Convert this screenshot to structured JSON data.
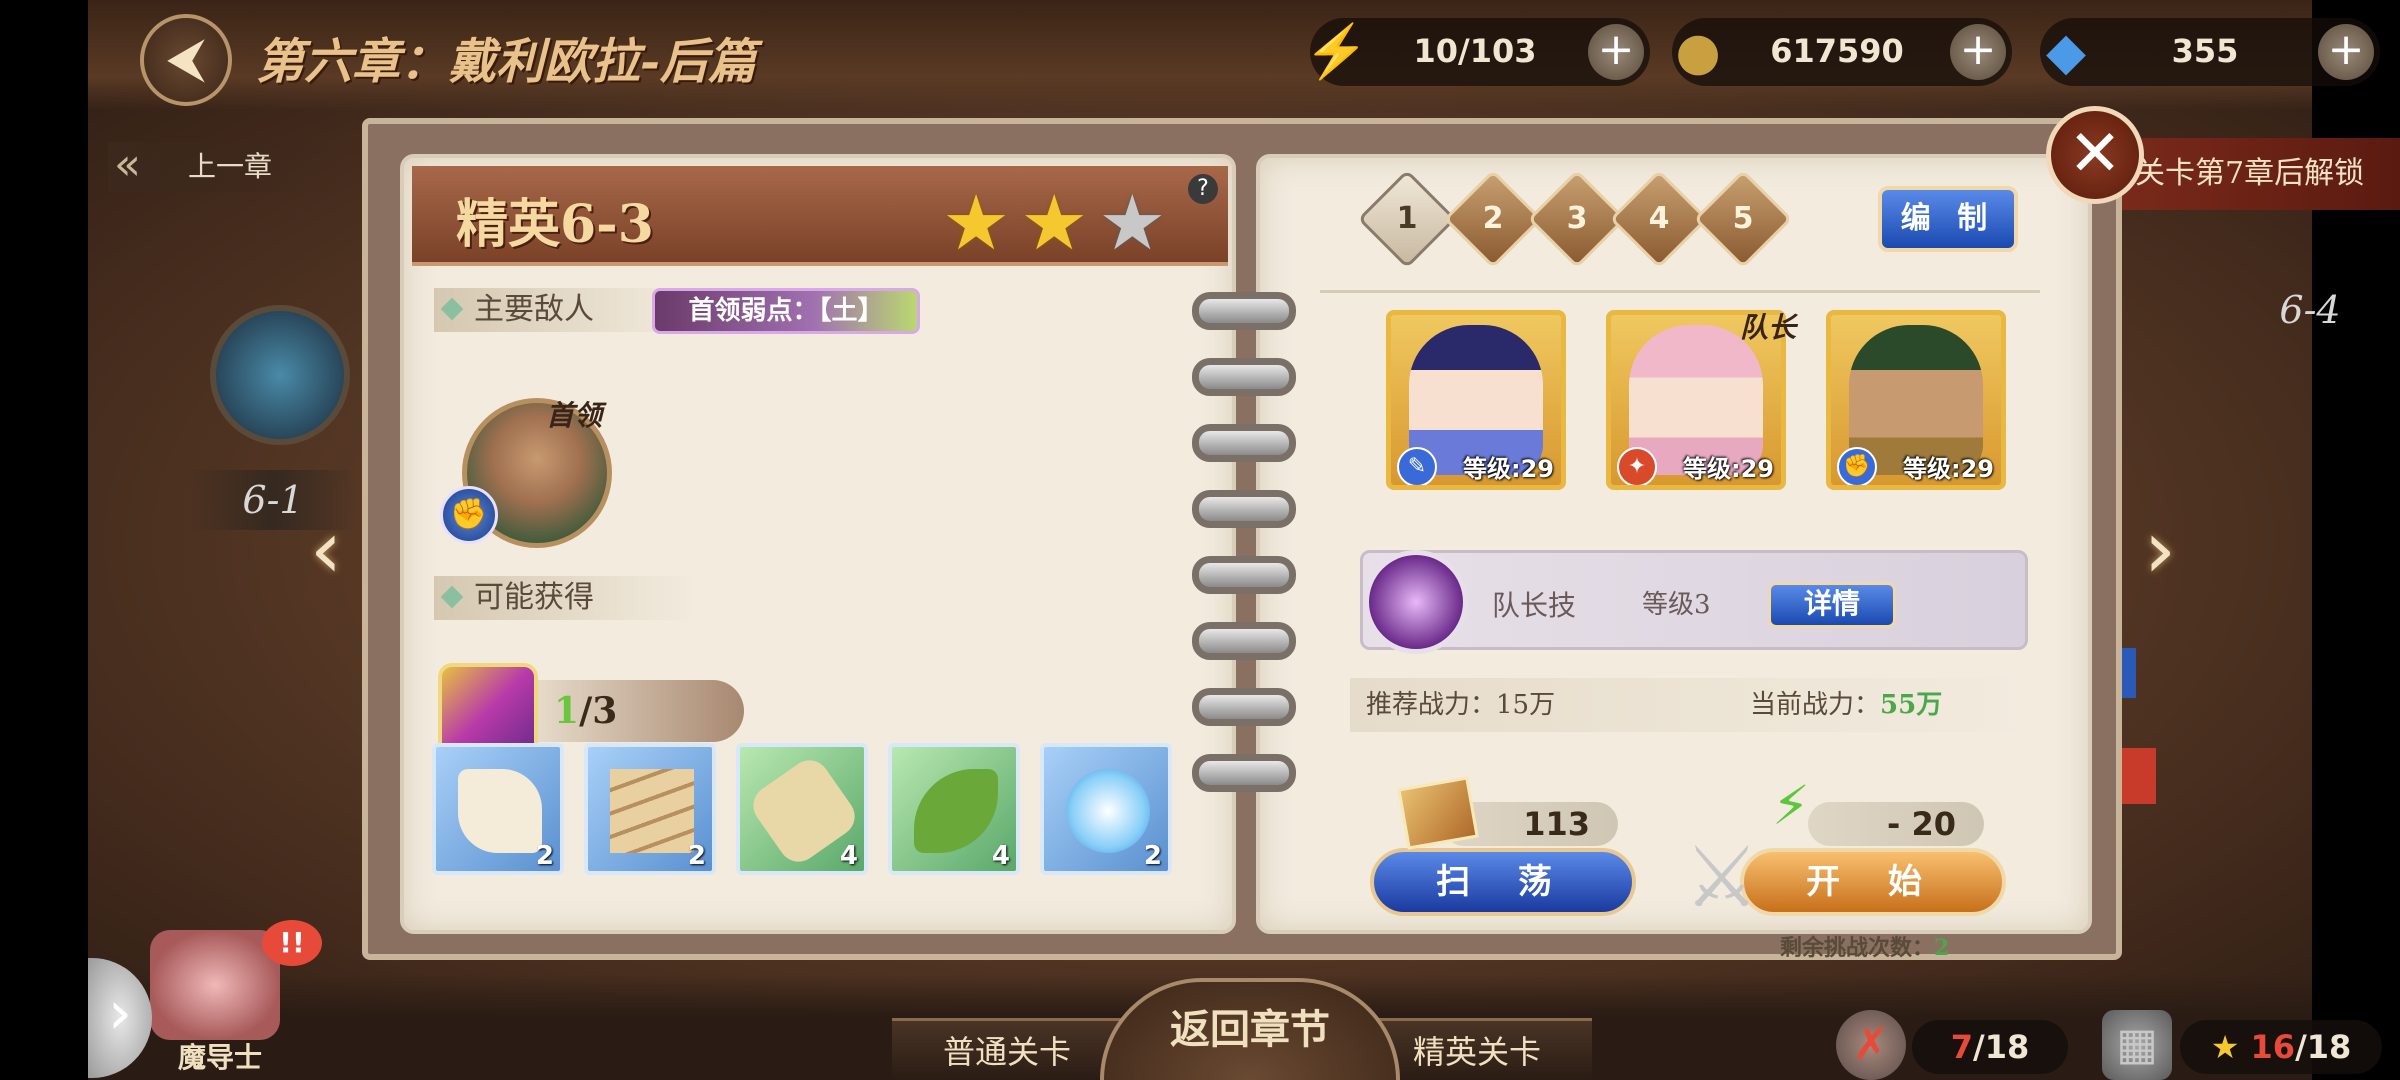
{
  "header": {
    "back_icon": "back-arrow-icon",
    "chapter_title": "第六章：戴利欧拉-后篇",
    "resources": [
      {
        "icon": "stamina-bolt-icon",
        "value": "10/103"
      },
      {
        "icon": "gold-coin-icon",
        "value": "617590"
      },
      {
        "icon": "blue-gem-icon",
        "value": "355"
      }
    ]
  },
  "map": {
    "prev_chapter": "上一章",
    "left_stage": "6-1",
    "right_stage": "6-4",
    "lock_notice": "关卡第7章后解锁"
  },
  "stage": {
    "name": "精英6-3",
    "stars_earned": 2,
    "stars_total": 3,
    "help": "?"
  },
  "enemies": {
    "section_label": "主要敌人",
    "weakness": "首领弱点：【土】",
    "boss_tag": "首领",
    "boss_element_icon": "fist-element-icon"
  },
  "rewards": {
    "section_label": "可能获得",
    "chest_current": "1",
    "chest_total": "/3",
    "drops": [
      {
        "name": "cloth-scroll",
        "qty": "2",
        "rarity": "blue"
      },
      {
        "name": "wood-planks",
        "qty": "2",
        "rarity": "blue"
      },
      {
        "name": "parchment-scroll",
        "qty": "4",
        "rarity": "green"
      },
      {
        "name": "green-hat",
        "qty": "4",
        "rarity": "green"
      },
      {
        "name": "ice-crystal",
        "qty": "2",
        "rarity": "blue"
      }
    ]
  },
  "team": {
    "slots": [
      "1",
      "2",
      "3",
      "4",
      "5"
    ],
    "active_slot": 0,
    "edit_label": "编 制",
    "leader_tag": "队长",
    "heroes": [
      {
        "name": "juvia",
        "level": "等级:29",
        "element_icon": "water-element-icon"
      },
      {
        "name": "meredy",
        "level": "等级:29",
        "element_icon": "fire-element-icon"
      },
      {
        "name": "boss-ally",
        "level": "等级:29",
        "element_icon": "fist-element-icon"
      }
    ]
  },
  "leader_skill": {
    "label": "队长技",
    "level": "等级3",
    "detail_label": "详情"
  },
  "power": {
    "recommended_label": "推荐战力：",
    "recommended_value": "15万",
    "current_label": "当前战力：",
    "current_value": "55万"
  },
  "costs": {
    "sweep_tickets": "113",
    "stamina_cost": "- 20"
  },
  "actions": {
    "sweep_label": "扫 荡",
    "start_label": "开 始",
    "remaining_label": "剩余挑战次数：",
    "remaining_value": "2"
  },
  "bottom": {
    "mage_label": "魔导士",
    "mage_alert": "!!",
    "normal_tab": "普通关卡",
    "return_label": "返回章节",
    "elite_tab": "精英关卡",
    "normal_progress_current": "7",
    "normal_progress_total": "/18",
    "star_progress_current": "16",
    "star_progress_total": "/18"
  },
  "colors": {
    "accent_blue": "#1a4ab0",
    "accent_orange": "#c8701a",
    "header_brown": "#7a4228",
    "power_green": "#4aa84a"
  }
}
